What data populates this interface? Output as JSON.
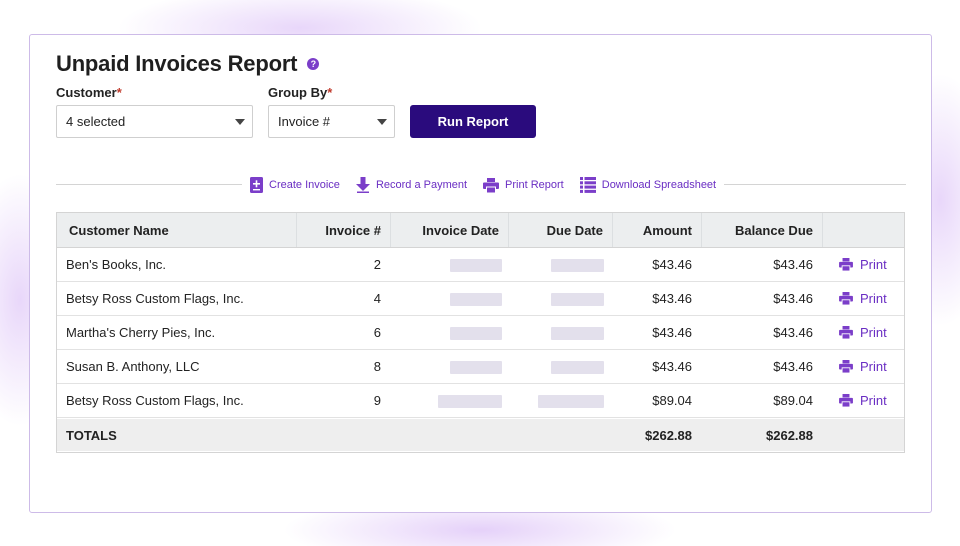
{
  "page": {
    "title": "Unpaid Invoices Report",
    "help_icon": "?"
  },
  "filters": {
    "customer_label": "Customer",
    "customer_value": "4 selected",
    "group_by_label": "Group By",
    "group_by_value": "Invoice #",
    "required_mark": "*",
    "run_button": "Run Report"
  },
  "actions": [
    {
      "label": "Create Invoice",
      "icon": "create-invoice-icon"
    },
    {
      "label": "Record a Payment",
      "icon": "record-payment-icon"
    },
    {
      "label": "Print Report",
      "icon": "printer-icon"
    },
    {
      "label": "Download Spreadsheet",
      "icon": "spreadsheet-icon"
    }
  ],
  "table": {
    "columns": [
      "Customer Name",
      "Invoice #",
      "Invoice Date",
      "Due Date",
      "Amount",
      "Balance Due"
    ],
    "print_label": "Print",
    "rows": [
      {
        "customer": "Ben's Books, Inc.",
        "invoice": "2",
        "amount": "$43.46",
        "balance": "$43.46"
      },
      {
        "customer": "Betsy Ross Custom Flags, Inc.",
        "invoice": "4",
        "amount": "$43.46",
        "balance": "$43.46"
      },
      {
        "customer": "Martha's Cherry Pies, Inc.",
        "invoice": "6",
        "amount": "$43.46",
        "balance": "$43.46"
      },
      {
        "customer": "Susan B. Anthony, LLC",
        "invoice": "8",
        "amount": "$43.46",
        "balance": "$43.46"
      },
      {
        "customer": "Betsy Ross Custom Flags, Inc.",
        "invoice": "9",
        "amount": "$89.04",
        "balance": "$89.04"
      }
    ],
    "totals": {
      "label": "TOTALS",
      "amount": "$262.88",
      "balance": "$262.88"
    }
  },
  "colors": {
    "accent": "#6a2ec3",
    "run_button": "#2a0b7d",
    "header_bg": "#eceeef",
    "required": "#c0392b"
  }
}
